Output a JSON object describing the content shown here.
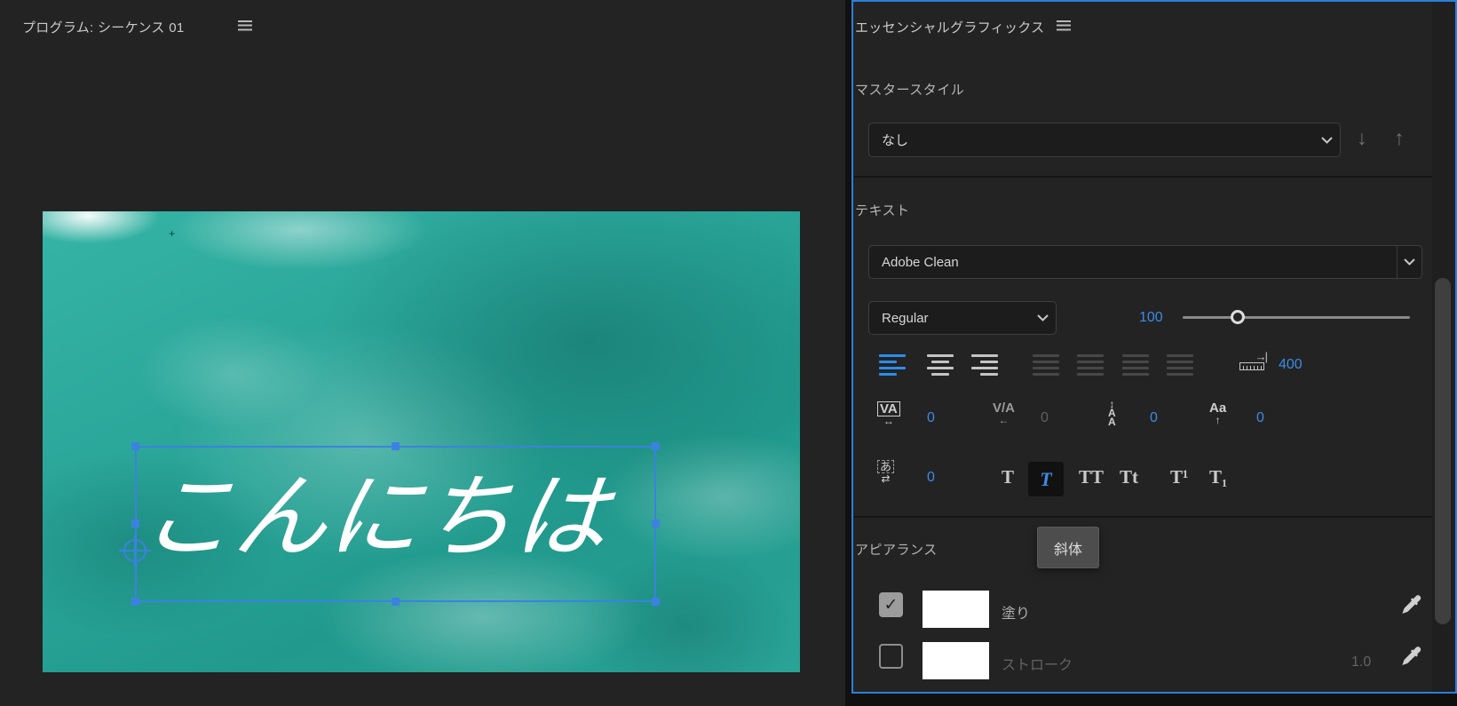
{
  "program_monitor": {
    "title": "プログラム: シーケンス 01",
    "overlay_text": "こんにちは"
  },
  "graphics_panel": {
    "title": "エッセンシャルグラフィックス",
    "master_style": {
      "label": "マスタースタイル",
      "selected": "なし"
    },
    "text": {
      "section_label": "テキスト",
      "font_family": "Adobe Clean",
      "font_style": "Regular",
      "font_size": "100",
      "ruler_value": "400",
      "tracking": "0",
      "kerning": "0",
      "leading": "0",
      "baseline_shift": "0",
      "tsume": "0",
      "style_buttons": {
        "faux_bold": "T",
        "faux_italic": "T",
        "all_caps": "TT",
        "small_caps": "Tt",
        "superscript": "T¹",
        "subscript": "T₁"
      }
    },
    "tooltip": "斜体",
    "appearance": {
      "section_label": "アピアランス",
      "fill_label": "塗り",
      "stroke_label": "ストローク",
      "stroke_width": "1.0",
      "fill_color": "#ffffff",
      "stroke_color": "#ffffff"
    },
    "colors": {
      "accent_blue": "#3d8be4",
      "panel_border_blue": "#2b7fd9",
      "selection_blue": "#3b82e0"
    },
    "icon_glyphs": {
      "tracking_icon_text": "VA",
      "tracking_arrow": "↔",
      "kerning_icon_text": "V/A",
      "kerning_arrow": "←",
      "leading_icon_text": "AA",
      "leading_arrow": "↕",
      "baseline_icon_text": "Aa",
      "baseline_arrow": "↑",
      "tsume_icon_text": "あ",
      "tsume_arrow": "⇄",
      "push_down_arrow": "↓",
      "push_up_arrow": "↑",
      "checkmark": "✓",
      "ruler_arrow": "→|",
      "frame_cross": "+"
    }
  }
}
